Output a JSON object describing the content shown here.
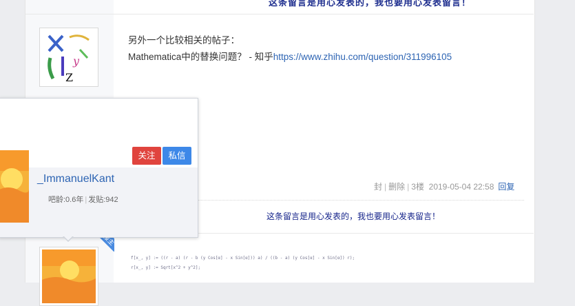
{
  "top_banner_text": "这条留言是用心发表的，我也要用心发表留言！",
  "post": {
    "line1": "另外一个比较相关的帖子：",
    "line2_prefix": "Mathematica中的替换问题？ - 知乎",
    "link_text": "https://www.zhihu.com/question/311996105"
  },
  "meta": {
    "seal": "封",
    "delete": "删除",
    "floor": "3楼",
    "datetime": "2019-05-04 22:58",
    "reply": "回复"
  },
  "signature": "这条留言是用心发表的，我也要用心发表留言！",
  "badge_text": "楼主",
  "card": {
    "follow_label": "关注",
    "message_label": "私信",
    "username": "_ImmanuelKant",
    "age_label": "吧龄:0.6年",
    "posts_label": "发贴:942"
  },
  "code_snippet": {
    "line1": "f[x_, y] := ((r - a) (r - b (y Cos[α] - x Sin[α])) a) / ((b - a) (y Cos[α] - x Sin[α]) r);",
    "line2": "r[x_, y] := Sqrt[x^2 + y^2];"
  },
  "colors": {
    "link": "#2d64b3",
    "follow": "#e0443e",
    "message": "#3d88e8",
    "signature": "#14238a"
  }
}
